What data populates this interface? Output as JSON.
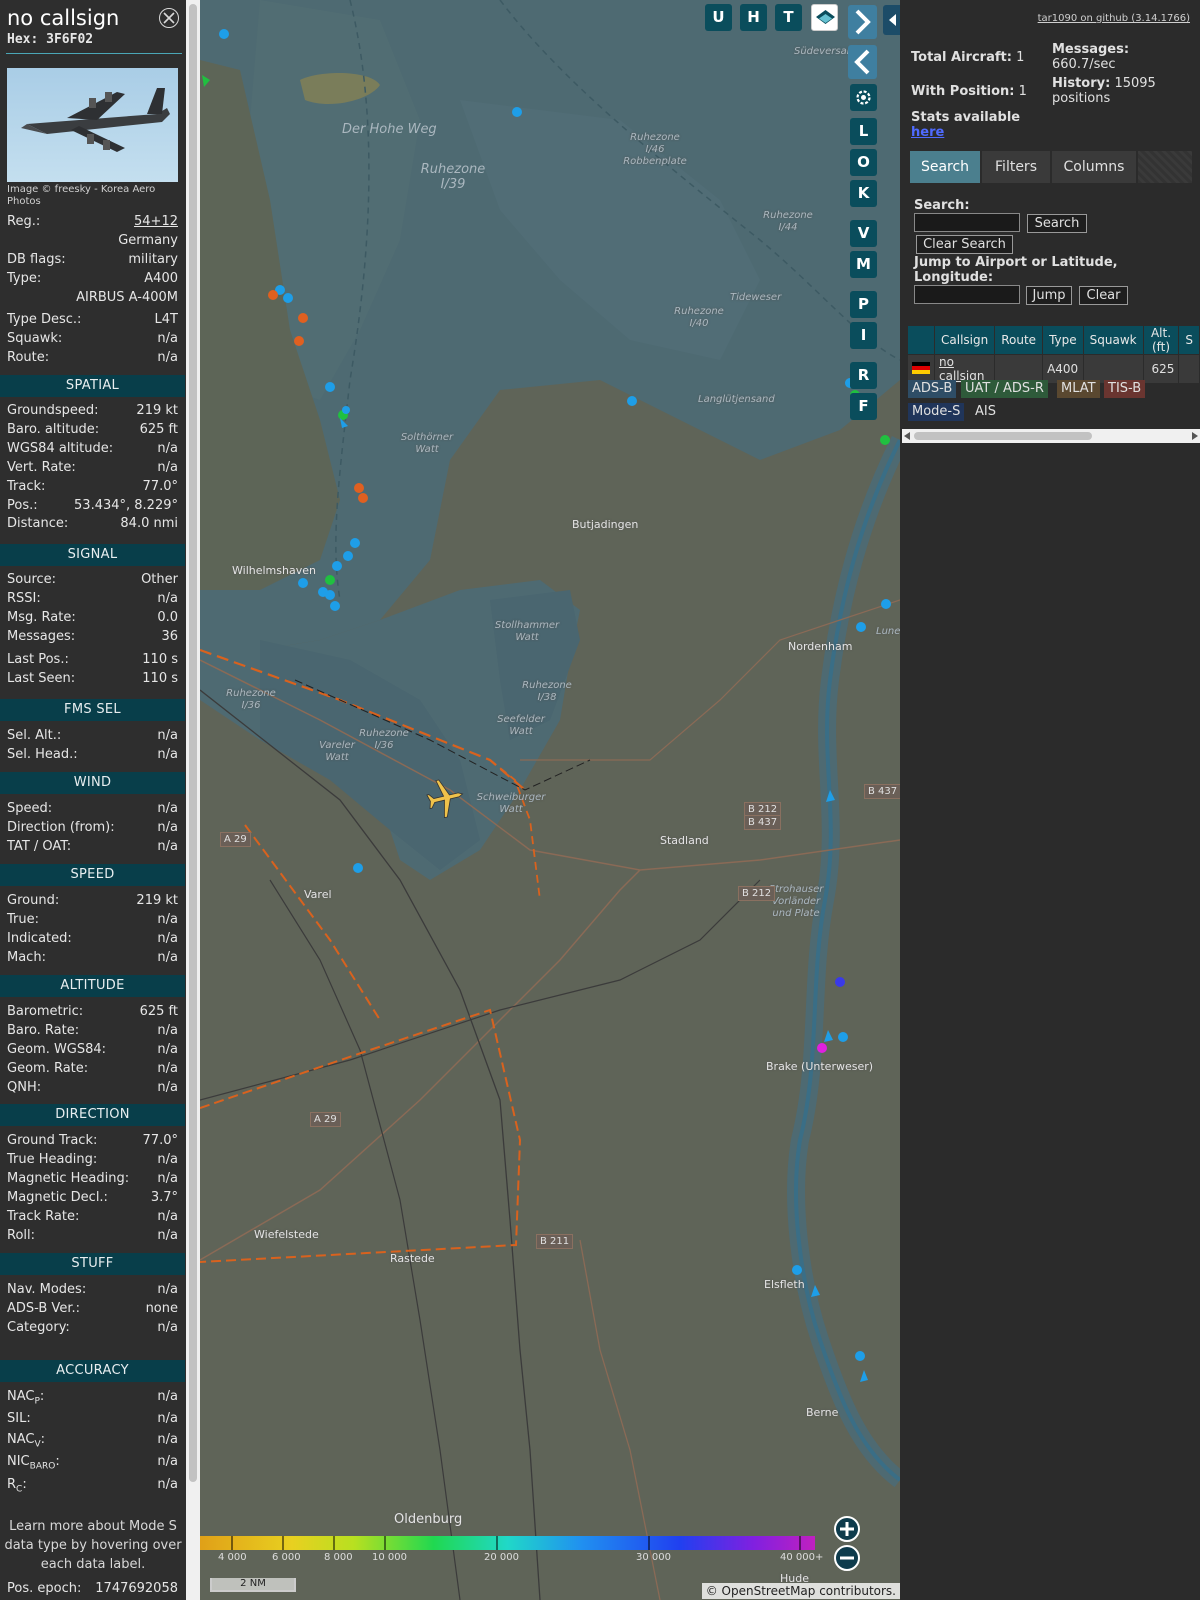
{
  "info": {
    "callsign": "no callsign",
    "hex_label": "Hex:",
    "hex": "3F6F02",
    "photo_credit": "Image © freesky - Korea Aero Photos",
    "reg_label": "Reg.:",
    "reg": "54+12",
    "country": "Germany",
    "dbflags_label": "DB flags:",
    "dbflags": "military",
    "type_label": "Type:",
    "type": "A400",
    "type_name": "AIRBUS A-400M",
    "typedesc_label": "Type Desc.:",
    "typedesc": "L4T",
    "squawk_label": "Squawk:",
    "squawk": "n/a",
    "route_label": "Route:",
    "route": "n/a"
  },
  "spatial": {
    "title": "SPATIAL",
    "rows": [
      {
        "k": "Groundspeed:",
        "v": "219 kt"
      },
      {
        "k": "Baro. altitude:",
        "v": "625 ft"
      },
      {
        "k": "WGS84 altitude:",
        "v": "n/a"
      },
      {
        "k": "Vert. Rate:",
        "v": "n/a"
      },
      {
        "k": "Track:",
        "v": "77.0°"
      },
      {
        "k": "Pos.:",
        "v": "53.434°, 8.229°"
      },
      {
        "k": "Distance:",
        "v": "84.0 nmi"
      }
    ]
  },
  "signal": {
    "title": "SIGNAL",
    "rows": [
      {
        "k": "Source:",
        "v": "Other"
      },
      {
        "k": "RSSI:",
        "v": "n/a"
      },
      {
        "k": "Msg. Rate:",
        "v": "0.0"
      },
      {
        "k": "Messages:",
        "v": "36"
      },
      {
        "k": "Last Pos.:",
        "v": "110 s"
      },
      {
        "k": "Last Seen:",
        "v": "110 s"
      }
    ]
  },
  "fms": {
    "title": "FMS SEL",
    "rows": [
      {
        "k": "Sel. Alt.:",
        "v": "n/a"
      },
      {
        "k": "Sel. Head.:",
        "v": "n/a"
      }
    ]
  },
  "wind": {
    "title": "WIND",
    "rows": [
      {
        "k": "Speed:",
        "v": "n/a"
      },
      {
        "k": "Direction (from):",
        "v": "n/a"
      },
      {
        "k": "TAT / OAT:",
        "v": "n/a"
      }
    ]
  },
  "speed": {
    "title": "SPEED",
    "rows": [
      {
        "k": "Ground:",
        "v": "219 kt"
      },
      {
        "k": "True:",
        "v": "n/a"
      },
      {
        "k": "Indicated:",
        "v": "n/a"
      },
      {
        "k": "Mach:",
        "v": "n/a"
      }
    ]
  },
  "altitude": {
    "title": "ALTITUDE",
    "rows": [
      {
        "k": "Barometric:",
        "v": "625 ft"
      },
      {
        "k": "Baro. Rate:",
        "v": "n/a"
      },
      {
        "k": "Geom. WGS84:",
        "v": "n/a"
      },
      {
        "k": "Geom. Rate:",
        "v": "n/a"
      },
      {
        "k": "QNH:",
        "v": "n/a"
      }
    ]
  },
  "direction": {
    "title": "DIRECTION",
    "rows": [
      {
        "k": "Ground Track:",
        "v": "77.0°"
      },
      {
        "k": "True Heading:",
        "v": "n/a"
      },
      {
        "k": "Magnetic Heading:",
        "v": "n/a"
      },
      {
        "k": "Magnetic Decl.:",
        "v": "3.7°"
      },
      {
        "k": "Track Rate:",
        "v": "n/a"
      },
      {
        "k": "Roll:",
        "v": "n/a"
      }
    ]
  },
  "stuff": {
    "title": "STUFF",
    "rows": [
      {
        "k": "Nav. Modes:",
        "v": "n/a"
      },
      {
        "k": "ADS-B Ver.:",
        "v": "none"
      },
      {
        "k": "Category:",
        "v": "n/a"
      }
    ]
  },
  "accuracy": {
    "title": "ACCURACY",
    "nacp_k": "NAC",
    "nacp_sub": "P",
    "nacp_v": "n/a",
    "sil_k": "SIL:",
    "sil_v": "n/a",
    "nacv_k": "NAC",
    "nacv_sub": "V",
    "nacv_v": "n/a",
    "nic_k": "NIC",
    "nic_sub": "BARO",
    "nic_v": "n/a",
    "rc_k": "R",
    "rc_sub": "C",
    "rc_v": "n/a",
    "colon": ":"
  },
  "learn_more": "Learn more about Mode S data type by hovering over each data label.",
  "pos_epoch_label": "Pos. epoch:",
  "pos_epoch": "1747692058",
  "map": {
    "buttons_top": [
      "U",
      "H",
      "T"
    ],
    "buttons_side": [
      "L",
      "O",
      "K",
      "V",
      "M",
      "P",
      "I",
      "R",
      "F"
    ],
    "labels": {
      "der_hohe_weg": "Der Hohe Weg",
      "ruhezone_139": "Ruhezone I/39",
      "ruhezone_146": "Ruhezone I/46 Robbenplate",
      "ruhezone_144": "Ruhezone I/44",
      "tideweser": "Tideweser",
      "ruhezone_140": "Ruhezone I/40",
      "langlutjensand": "Langlütjensand",
      "solthorner": "Solthörner Watt",
      "butjadingen": "Butjadingen",
      "wilhelmshaven": "Wilhelmshaven",
      "stollhammer": "Stollhammer Watt",
      "ruhezone_138": "Ruhezone I/38",
      "seefelder": "Seefelder Watt",
      "nordenham": "Nordenham",
      "ruhezone_136a": "Ruhezone I/36",
      "ruhezone_136b": "Ruhezone I/36",
      "vareler": "Vareler Watt",
      "schweiburger": "Schweiburger Watt",
      "stadland": "Stadland",
      "strohauser": "Strohauser Vorländer und Plate",
      "varel": "Varel",
      "brake": "Brake (Unterweser)",
      "wiefelstede": "Wiefelstede",
      "rastede": "Rastede",
      "elsfleth": "Elsfleth",
      "berne": "Berne",
      "oldenburg": "Oldenburg",
      "hude": "Hude",
      "sudeversand": "Südeversand",
      "lune": "Lune"
    },
    "roads": {
      "b437a": "B 437",
      "b212a": "B 212",
      "b437b": "B 437",
      "b212b": "B 212",
      "a29a": "A 29",
      "a29b": "A 29",
      "b211": "B 211"
    },
    "legend_labels": [
      "4 000",
      "6 000",
      "8 000",
      "10 000",
      "20 000",
      "30 000",
      "40 000+"
    ],
    "scale": "2 NM",
    "attribution": "© OpenStreetMap contributors."
  },
  "right": {
    "github": "tar1090 on github (3.14.1766)",
    "total_label": "Total Aircraft:",
    "total": "1",
    "withpos_label": "With Position:",
    "withpos": "1",
    "messages_label": "Messages:",
    "messages": "660.7/sec",
    "history_label": "History:",
    "history": "15095 positions",
    "stats_label": "Stats available",
    "stats_link": "here",
    "tabs": [
      "Search",
      "Filters",
      "Columns"
    ],
    "search_label": "Search:",
    "search_button": "Search",
    "clear_search_button": "Clear Search",
    "jump_label": "Jump to Airport or Latitude, Longitude:",
    "jump_button": "Jump",
    "clear_button": "Clear",
    "table": {
      "headers": [
        "",
        "Callsign",
        "Route",
        "Type",
        "Squawk",
        "Alt. (ft)",
        "S"
      ],
      "row": {
        "callsign": "no callsign",
        "route": "",
        "type": "A400",
        "squawk": "",
        "alt": "625"
      }
    },
    "sources": [
      "ADS-B",
      "UAT / ADS-R",
      "MLAT",
      "TIS-B",
      "Mode-S",
      "AIS"
    ]
  },
  "colors": {
    "header": "#083e4a",
    "accent": "#4b7f8e",
    "track": "#d9621e",
    "aircraft": "#f0c24a"
  }
}
